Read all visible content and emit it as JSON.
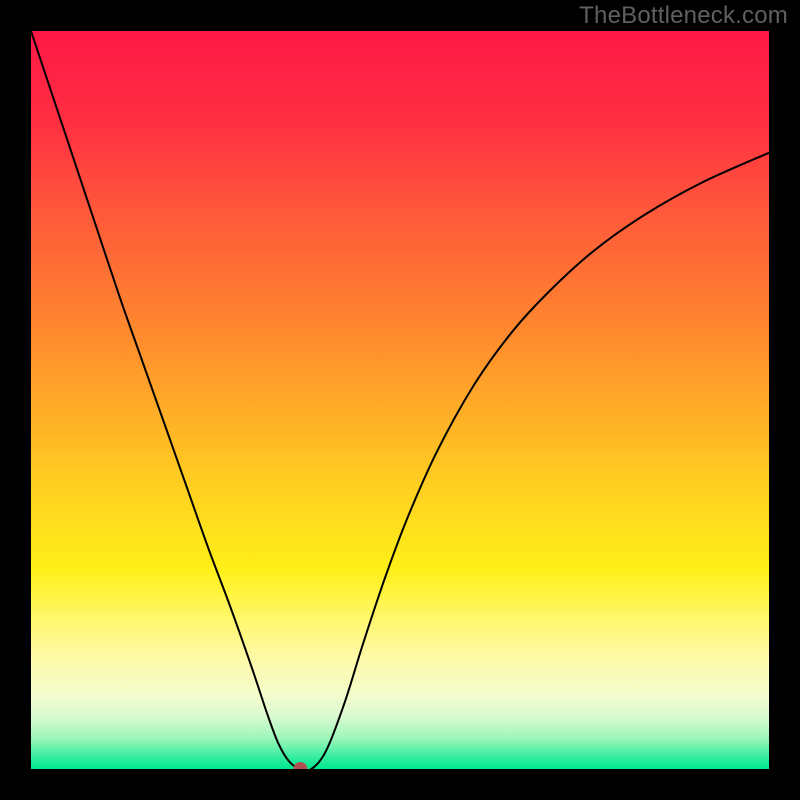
{
  "watermark": "TheBottleneck.com",
  "chart_data": {
    "type": "line",
    "title": "",
    "xlabel": "",
    "ylabel": "",
    "xlim": [
      0,
      100
    ],
    "ylim": [
      0,
      100
    ],
    "grid": false,
    "legend": false,
    "marker": {
      "x": 36.5,
      "y": 0,
      "color": "#b05050",
      "radius": 7
    },
    "background_gradient": {
      "stops": [
        {
          "offset": 0.0,
          "color": "#ff1846"
        },
        {
          "offset": 0.12,
          "color": "#ff2e42"
        },
        {
          "offset": 0.25,
          "color": "#ff5a3a"
        },
        {
          "offset": 0.38,
          "color": "#ff8030"
        },
        {
          "offset": 0.5,
          "color": "#ffa828"
        },
        {
          "offset": 0.62,
          "color": "#ffd020"
        },
        {
          "offset": 0.73,
          "color": "#fff018"
        },
        {
          "offset": 0.8,
          "color": "#fff870"
        },
        {
          "offset": 0.85,
          "color": "#fffaa8"
        },
        {
          "offset": 0.9,
          "color": "#f4fccc"
        },
        {
          "offset": 0.93,
          "color": "#d8fad0"
        },
        {
          "offset": 0.96,
          "color": "#98f6b8"
        },
        {
          "offset": 0.985,
          "color": "#30eca0"
        },
        {
          "offset": 1.0,
          "color": "#00e890"
        }
      ]
    },
    "series": [
      {
        "name": "bottleneck-curve",
        "color": "#000000",
        "width": 2,
        "x": [
          0.0,
          3.0,
          6.0,
          9.0,
          12.0,
          15.0,
          18.0,
          21.0,
          24.0,
          27.0,
          30.0,
          32.0,
          33.5,
          35.0,
          36.5,
          38.0,
          40.0,
          42.5,
          45.0,
          48.0,
          51.0,
          55.0,
          60.0,
          65.0,
          70.0,
          76.0,
          83.0,
          91.0,
          100.0
        ],
        "values": [
          100.0,
          91.0,
          82.0,
          73.0,
          64.0,
          55.5,
          47.0,
          38.5,
          30.0,
          22.0,
          13.5,
          7.5,
          3.5,
          1.0,
          0.0,
          0.0,
          2.5,
          9.0,
          17.0,
          26.0,
          34.0,
          43.0,
          52.0,
          59.0,
          64.5,
          70.0,
          75.0,
          79.5,
          83.5
        ]
      }
    ]
  }
}
